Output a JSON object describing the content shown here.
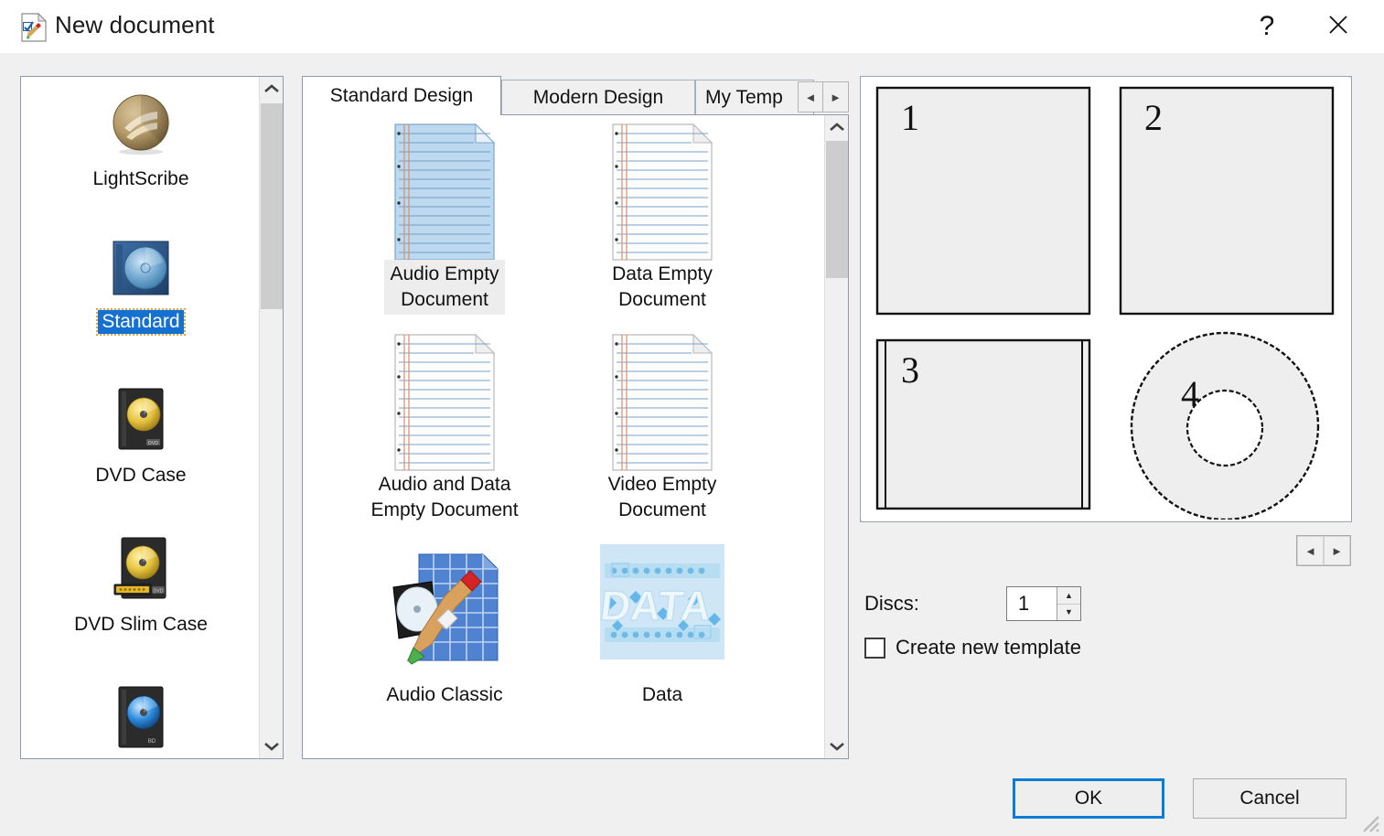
{
  "window": {
    "title": "New document",
    "icon": "new-document-icon",
    "help_label": "?",
    "close_label": "✕"
  },
  "sidebar": {
    "items": [
      {
        "label": "LightScribe",
        "icon": "lightscribe-disc-icon",
        "selected": false
      },
      {
        "label": "Standard",
        "icon": "standard-jewel-case-icon",
        "selected": true
      },
      {
        "label": "DVD Case",
        "icon": "dvd-case-icon",
        "selected": false
      },
      {
        "label": "DVD Slim Case",
        "icon": "dvd-slim-case-icon",
        "selected": false
      },
      {
        "label": "",
        "icon": "blu-ray-case-icon",
        "selected": false
      }
    ],
    "scroll": {
      "up_arrow": "∧",
      "down_arrow": "∨"
    }
  },
  "tabs": {
    "items": [
      {
        "label": "Standard Design",
        "active": true
      },
      {
        "label": "Modern Design",
        "active": false
      },
      {
        "label": "My Temp",
        "active": false
      }
    ],
    "nav_prev": "◄",
    "nav_next": "►"
  },
  "templates": {
    "items": [
      {
        "label": "Audio Empty\nDocument",
        "icon": "lined-page-audio-icon",
        "selected": true
      },
      {
        "label": "Data Empty\nDocument",
        "icon": "lined-page-data-icon",
        "selected": false
      },
      {
        "label": "Audio and Data\nEmpty Document",
        "icon": "lined-page-audio-data-icon",
        "selected": false
      },
      {
        "label": "Video Empty\nDocument",
        "icon": "lined-page-video-icon",
        "selected": false
      },
      {
        "label": "Audio Classic",
        "icon": "audio-classic-icon",
        "selected": false
      },
      {
        "label": "Data",
        "icon": "data-template-icon",
        "selected": false
      }
    ],
    "scroll": {
      "up_arrow": "∧",
      "down_arrow": "∨"
    }
  },
  "preview": {
    "panels": [
      {
        "number": "1",
        "shape": "rect"
      },
      {
        "number": "2",
        "shape": "rect"
      },
      {
        "number": "3",
        "shape": "rect-with-spine"
      },
      {
        "number": "4",
        "shape": "disc"
      }
    ],
    "nav_prev": "◄",
    "nav_next": "►"
  },
  "options": {
    "discs_label": "Discs:",
    "discs_value": "1",
    "spin_up": "▲",
    "spin_down": "▼",
    "create_new_template_label": "Create new template",
    "create_new_template_checked": false
  },
  "footer": {
    "ok_label": "OK",
    "cancel_label": "Cancel"
  },
  "colors": {
    "accent_focus": "#0a7cd6",
    "selection_blue": "#1571d1",
    "focus_dotted": "#e8a33d",
    "dialog_bg": "#f0f0f0",
    "panel_bg": "#ffffff"
  }
}
